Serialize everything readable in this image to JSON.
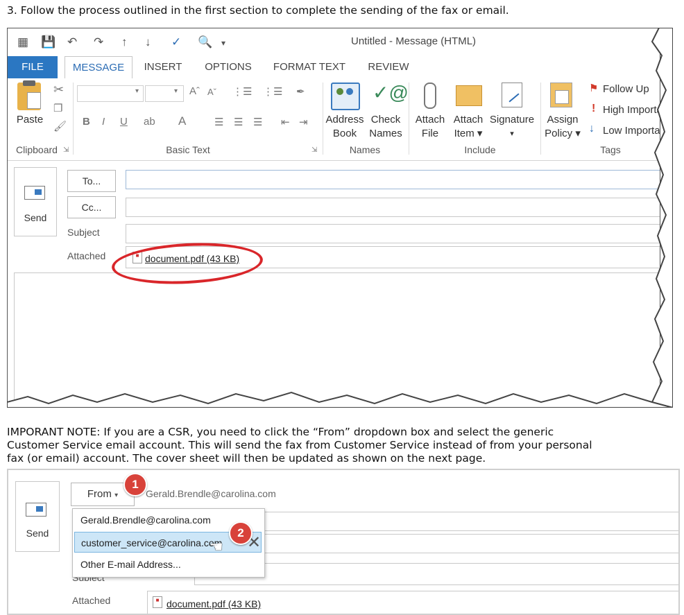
{
  "step_text": "3. Follow the process outlined in the first section to complete the sending of the fax or email.",
  "note_lines": [
    "IMPORANT NOTE: If you are a CSR, you need to click the “From” dropdown box and select the generic",
    "Customer Service email account.  This will send the fax from Customer Service instead of from your personal",
    "fax (or email) account.  The cover sheet will then be updated as shown on the next page."
  ],
  "window_title": "Untitled - Message (HTML)",
  "tabs": [
    "FILE",
    "MESSAGE",
    "INSERT",
    "OPTIONS",
    "FORMAT TEXT",
    "REVIEW"
  ],
  "ribbon": {
    "paste": "Paste",
    "clipboard": "Clipboard",
    "basic_text": "Basic Text",
    "address_book": [
      "Address",
      "Book"
    ],
    "check_names": [
      "Check",
      "Names"
    ],
    "names": "Names",
    "attach_file": [
      "Attach",
      "File"
    ],
    "attach_item": [
      "Attach",
      "Item ▾"
    ],
    "signature": [
      "Signature",
      "▾"
    ],
    "include": "Include",
    "assign_policy": [
      "Assign",
      "Policy ▾"
    ],
    "follow_up": "Follow Up",
    "high_importance": "High Importance",
    "low_importance": "Low Importance",
    "tags": "Tags"
  },
  "compose": {
    "send": "Send",
    "to": "To...",
    "cc": "Cc...",
    "subject": "Subject",
    "attached": "Attached",
    "attachment": "document.pdf (43 KB)",
    "from": "From",
    "from_address": "Gerald.Brendle@carolina.com",
    "subject_partial": "Subject"
  },
  "from_options": [
    "Gerald.Brendle@carolina.com",
    "customer_service@carolina.com",
    "Other E-mail Address..."
  ],
  "badges": [
    "1",
    "2"
  ],
  "colors": {
    "file_tab": "#2b77c2",
    "highlight_circle": "#d9262a",
    "badge": "#d8423a",
    "selected_option": "#cde6f7"
  }
}
